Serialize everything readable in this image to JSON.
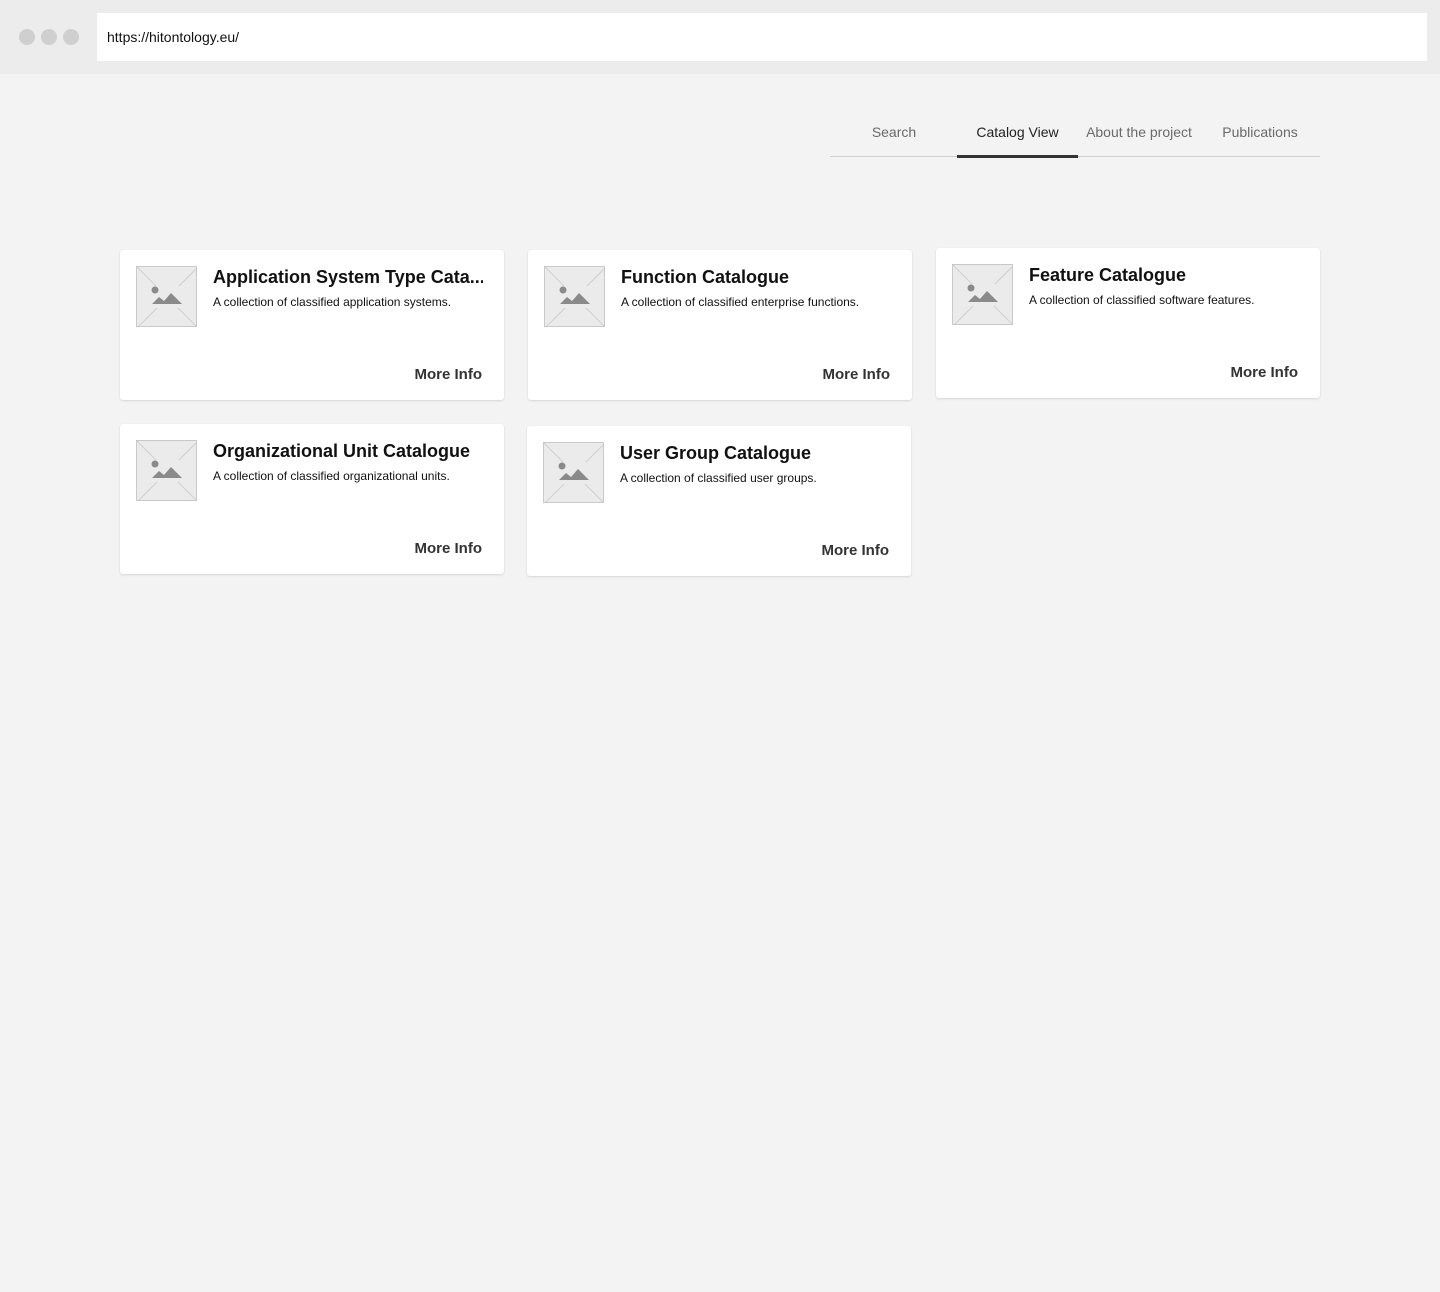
{
  "browser": {
    "url": "https://hitontology.eu/"
  },
  "nav": {
    "tabs": [
      {
        "label": "Search",
        "active": false
      },
      {
        "label": "Catalog View",
        "active": true
      },
      {
        "label": "About the project",
        "active": false
      },
      {
        "label": "Publications",
        "active": false
      }
    ]
  },
  "catalogs": [
    {
      "title": "Application System Type Cata...",
      "description": "A collection of classified application systems.",
      "button": "More Info",
      "icon": "image-placeholder-icon"
    },
    {
      "title": "Function Catalogue",
      "description": "A collection of classified enterprise functions.",
      "button": "More Info",
      "icon": "image-placeholder-icon"
    },
    {
      "title": "Feature Catalogue",
      "description": "A collection of classified software features.",
      "button": "More Info",
      "icon": "image-placeholder-icon"
    },
    {
      "title": "Organizational Unit Catalogue",
      "description": "A collection of classified organizational units.",
      "button": "More Info",
      "icon": "image-placeholder-icon"
    },
    {
      "title": "User Group Catalogue",
      "description": "A collection of classified user groups.",
      "button": "More Info",
      "icon": "image-placeholder-icon"
    }
  ],
  "colors": {
    "page_background": "#f3f3f3",
    "chrome_background": "#ececec",
    "active_tab_indicator": "#333333",
    "card_background": "#ffffff"
  }
}
